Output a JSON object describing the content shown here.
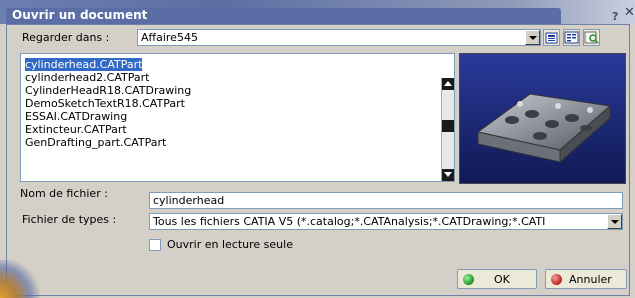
{
  "window": {
    "title": "Ouvrir un document",
    "help": "?",
    "close": "✕"
  },
  "look_in": {
    "label": "Regarder dans :",
    "value": "Affaire545"
  },
  "files": [
    "cylinderhead.CATPart",
    "cylinderhead2.CATPart",
    "CylinderHeadR18.CATDrawing",
    "DemoSketchTextR18.CATPart",
    "ESSAI.CATDrawing",
    "Extincteur.CATPart",
    "GenDrafting_part.CATPart"
  ],
  "filename": {
    "label": "Nom de fichier :",
    "value": "cylinderhead"
  },
  "filetype": {
    "label": "Fichier de types :",
    "value": "Tous les fichiers CATIA V5 (*.catalog;*.CATAnalysis;*.CATDrawing;*.CATI"
  },
  "readonly": {
    "label": "Ouvrir en lecture seule",
    "checked": false
  },
  "buttons": {
    "ok": "OK",
    "cancel": "Annuler"
  },
  "colors": {
    "selection": "#316ac5",
    "ok_dot": "#2e9e2e",
    "cancel_dot": "#c83030",
    "preview_bg": "#1c2b7a"
  }
}
